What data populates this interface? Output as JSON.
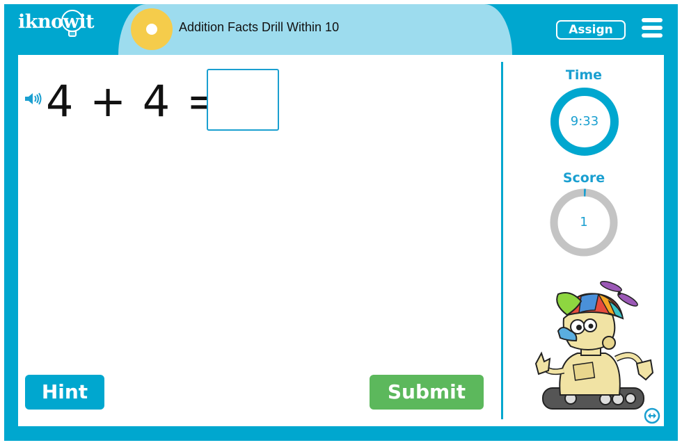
{
  "app": {
    "logo_text": "iknowit",
    "activity_title": "Addition Facts Drill Within 10",
    "colors": {
      "frame": "#00a7cf",
      "title_band": "#9ddcee",
      "title_circle": "#f5cc4b",
      "hint": "#00a7cf",
      "submit": "#5cb85c",
      "ring_time": "#00a7cf",
      "ring_score_track": "#c4c4c4"
    }
  },
  "header": {
    "assign_label": "Assign",
    "menu_icon": "hamburger-menu-icon"
  },
  "question": {
    "speaker_icon": "speaker-icon",
    "text": "4 + 4 =",
    "answer_value": "",
    "answer_placeholder": ""
  },
  "buttons": {
    "hint_label": "Hint",
    "submit_label": "Submit"
  },
  "stats": {
    "time_label": "Time",
    "time_value": "9:33",
    "time_remaining_fraction": 1.0,
    "score_label": "Score",
    "score_value": "1",
    "score_progress_fraction": 0.01
  },
  "footer": {
    "resize_icon": "resize-arrows-icon"
  }
}
